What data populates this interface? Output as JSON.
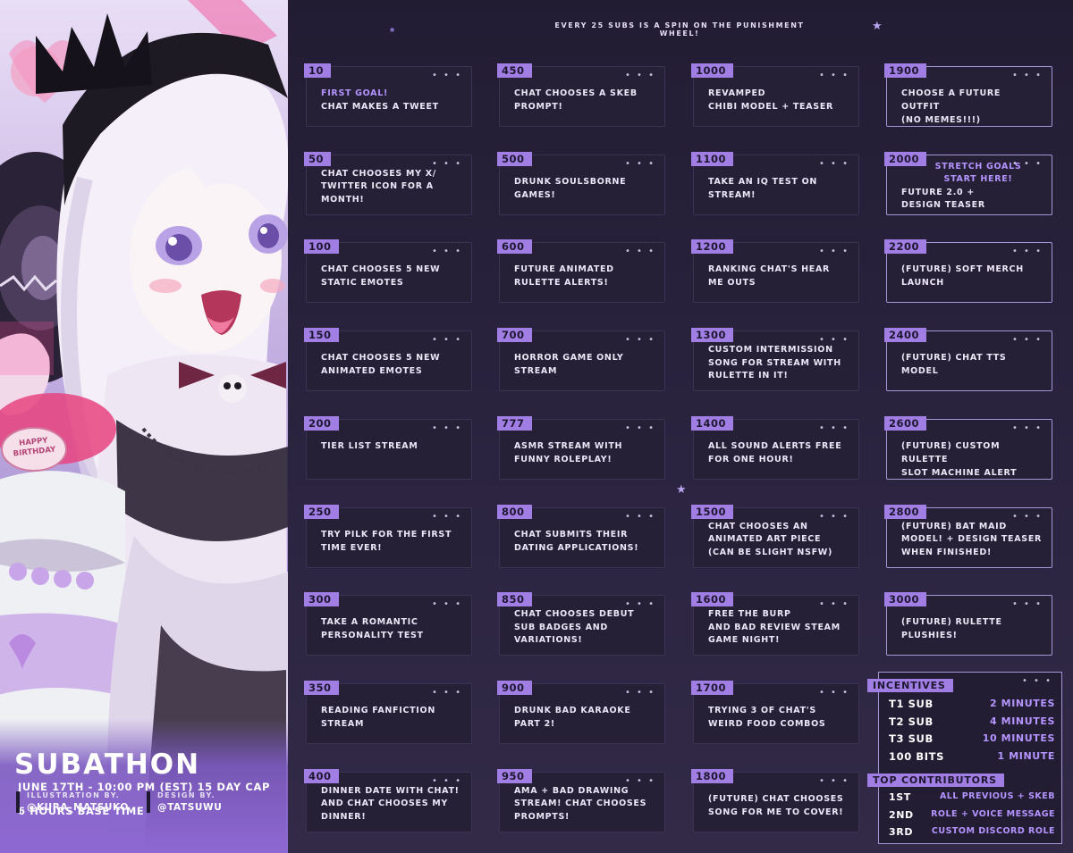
{
  "header": "EVERY 25 SUBS IS A SPIN ON THE PUNISHMENT WHEEL!",
  "event": {
    "title": "SUBATHON",
    "date_line": "JUNE 17TH - 10:00 PM (EST) 15 DAY CAP",
    "base_time": "6 HOURS BASE TIME",
    "illustration_label": "ILLUSTRATION BY.",
    "illustration_handle": "@KURA_MATSUKO",
    "design_label": "DESIGN BY.",
    "design_handle": "@TATSUWU"
  },
  "art_text": {
    "cake_line1": "HAPPY",
    "cake_line2": "BIRTHDAY"
  },
  "goals": {
    "col1": [
      {
        "num": "10",
        "accent": "FIRST GOAL!",
        "text": "CHAT MAKES A TWEET"
      },
      {
        "num": "50",
        "text": "CHAT CHOOSES MY X/\nTWITTER ICON FOR A\nMONTH!"
      },
      {
        "num": "100",
        "text": "CHAT CHOOSES 5 NEW\nSTATIC EMOTES"
      },
      {
        "num": "150",
        "text": "CHAT CHOOSES 5 NEW\nANIMATED EMOTES"
      },
      {
        "num": "200",
        "text": "TIER LIST STREAM"
      },
      {
        "num": "250",
        "text": "TRY PILK FOR THE FIRST\nTIME EVER!"
      },
      {
        "num": "300",
        "text": "TAKE A ROMANTIC\nPERSONALITY TEST"
      },
      {
        "num": "350",
        "text": "READING FANFICTION\nSTREAM"
      },
      {
        "num": "400",
        "text": "DINNER DATE WITH CHAT!\nAND CHAT CHOOSES MY\nDINNER!"
      }
    ],
    "col2": [
      {
        "num": "450",
        "text": "CHAT CHOOSES A SKEB\nPROMPT!"
      },
      {
        "num": "500",
        "text": "DRUNK SOULSBORNE\nGAMES!"
      },
      {
        "num": "600",
        "text": "FUTURE ANIMATED\nRULETTE ALERTS!"
      },
      {
        "num": "700",
        "text": "HORROR GAME ONLY\nSTREAM"
      },
      {
        "num": "777",
        "text": "ASMR STREAM WITH\nFUNNY ROLEPLAY!"
      },
      {
        "num": "800",
        "text": "CHAT SUBMITS THEIR\nDATING APPLICATIONS!"
      },
      {
        "num": "850",
        "text": "CHAT CHOOSES DEBUT\nSUB BADGES AND\nVARIATIONS!"
      },
      {
        "num": "900",
        "text": "DRUNK BAD KARAOKE\nPART 2!"
      },
      {
        "num": "950",
        "text": "AMA + BAD DRAWING\nSTREAM! CHAT CHOOSES\nPROMPTS!"
      }
    ],
    "col3": [
      {
        "num": "1000",
        "text": "REVAMPED\nCHIBI MODEL + TEASER"
      },
      {
        "num": "1100",
        "text": "TAKE AN IQ TEST ON\nSTREAM!"
      },
      {
        "num": "1200",
        "text": "RANKING CHAT'S HEAR\nME OUTS"
      },
      {
        "num": "1300",
        "text": "CUSTOM INTERMISSION\nSONG FOR STREAM WITH\nRULETTE IN IT!"
      },
      {
        "num": "1400",
        "text": "ALL SOUND ALERTS FREE\nFOR ONE HOUR!"
      },
      {
        "num": "1500",
        "text": "CHAT CHOOSES AN\nANIMATED ART PIECE\n(CAN BE SLIGHT NSFW)"
      },
      {
        "num": "1600",
        "text": "FREE THE BURP\nAND BAD REVIEW STEAM\nGAME NIGHT!"
      },
      {
        "num": "1700",
        "text": "TRYING 3 OF CHAT'S\nWEIRD FOOD COMBOS"
      },
      {
        "num": "1800",
        "text": "(FUTURE) CHAT CHOOSES\nSONG FOR ME TO COVER!"
      }
    ],
    "col4": [
      {
        "num": "1900",
        "text": "CHOOSE A FUTURE OUTFIT\n(NO MEMES!!!)"
      },
      {
        "num": "2000",
        "accent": "STRETCH GOALS\nSTART HERE!",
        "text": "FUTURE 2.0 +\nDESIGN TEASER"
      },
      {
        "num": "2200",
        "text": "(FUTURE) SOFT MERCH\nLAUNCH"
      },
      {
        "num": "2400",
        "text": "(FUTURE) CHAT TTS\nMODEL"
      },
      {
        "num": "2600",
        "text": "(FUTURE) CUSTOM RULETTE\n SLOT MACHINE ALERT"
      },
      {
        "num": "2800",
        "text": "(FUTURE) BAT MAID\nMODEL! + DESIGN TEASER\nWHEN FINISHED!"
      },
      {
        "num": "3000",
        "text": "(FUTURE) RULETTE\nPLUSHIES!"
      }
    ]
  },
  "incentives": {
    "title": "INCENTIVES",
    "rows": [
      {
        "k": "T1 SUB",
        "v": "2 MINUTES"
      },
      {
        "k": "T2 SUB",
        "v": "4 MINUTES"
      },
      {
        "k": "T3 SUB",
        "v": "10 MINUTES"
      },
      {
        "k": "100 BITS",
        "v": "1 MINUTE"
      }
    ],
    "contrib_title": "TOP CONTRIBUTORS",
    "contrib": [
      {
        "k": "1ST",
        "v": "ALL PREVIOUS + SKEB"
      },
      {
        "k": "2ND",
        "v": "ROLE + VOICE MESSAGE"
      },
      {
        "k": "3RD",
        "v": "CUSTOM DISCORD ROLE"
      }
    ]
  },
  "dots_glyph": "• • •",
  "colors": {
    "accent": "#a07ee3",
    "accent_text": "#b494ff",
    "background": "#241e35",
    "card": "#262037"
  }
}
